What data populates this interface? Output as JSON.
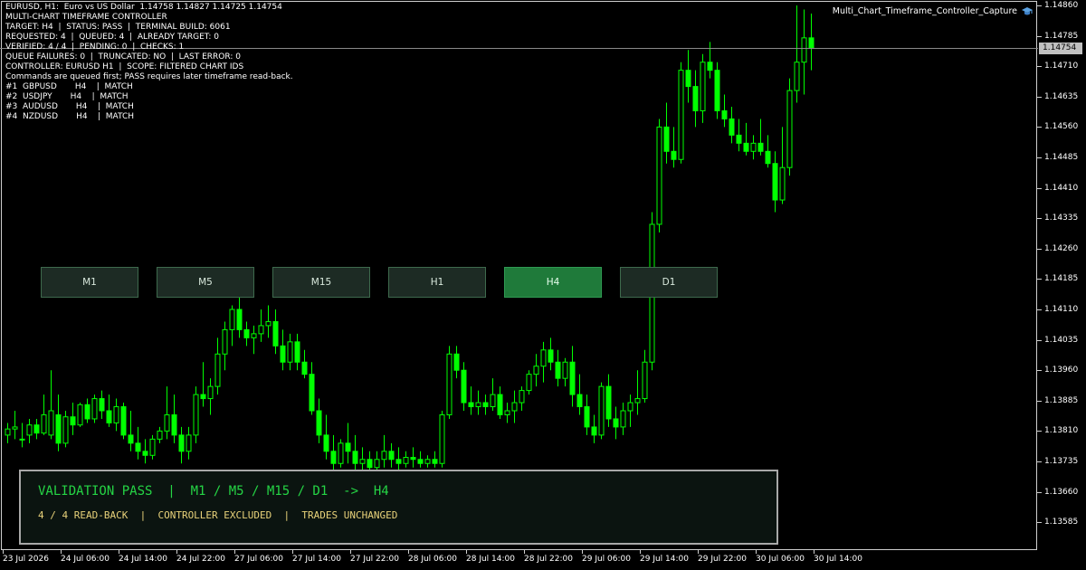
{
  "colors": {
    "background": "#000000",
    "candle_bull": "#00ff00",
    "grid_text": "#ffffff",
    "button_active": "#1f7a3a",
    "panel_title": "#25d545",
    "panel_sub": "#e8d27a"
  },
  "overlay": {
    "line1": "EURUSD, H1:  Euro vs US Dollar  1.14758 1.14827 1.14725 1.14754",
    "line2": "MULTI-CHART TIMEFRAME CONTROLLER",
    "line3": "TARGET: H4  |  STATUS: PASS  |  TERMINAL BUILD: 6061",
    "line4": "REQUESTED: 4  |  QUEUED: 4  |  ALREADY TARGET: 0",
    "line5": "VERIFIED: 4 / 4  |  PENDING: 0  |  CHECKS: 1",
    "line6": "QUEUE FAILURES: 0  |  TRUNCATED: NO  |  LAST ERROR: 0",
    "line7": "CONTROLLER: EURUSD H1  |  SCOPE: FILTERED CHART IDS",
    "line8": "Commands are queued first; PASS requires later timeframe read-back.",
    "line9": "#1  GBPUSD       H4    |  MATCH",
    "line10": "#2  USDJPY       H4    |  MATCH",
    "line11": "#3  AUDUSD       H4    |  MATCH",
    "line12": "#4  NZDUSD       H4    |  MATCH"
  },
  "script_name": "Multi_Chart_Timeframe_Controller_Capture",
  "script_icon": "graduation-cap-icon",
  "current_price": "1.14754",
  "price_labels": [
    "1.14860",
    "1.14785",
    "1.14710",
    "1.14635",
    "1.14560",
    "1.14485",
    "1.14410",
    "1.14335",
    "1.14260",
    "1.14185",
    "1.14110",
    "1.14035",
    "1.13960",
    "1.13885",
    "1.13810",
    "1.13735",
    "1.13660",
    "1.13585"
  ],
  "time_labels": [
    "23 Jul 2026",
    "24 Jul 06:00",
    "24 Jul 14:00",
    "24 Jul 22:00",
    "27 Jul 06:00",
    "27 Jul 14:00",
    "27 Jul 22:00",
    "28 Jul 06:00",
    "28 Jul 14:00",
    "28 Jul 22:00",
    "29 Jul 06:00",
    "29 Jul 14:00",
    "29 Jul 22:00",
    "30 Jul 06:00",
    "30 Jul 14:00"
  ],
  "buttons": [
    {
      "label": "M1",
      "active": false
    },
    {
      "label": "M5",
      "active": false
    },
    {
      "label": "M15",
      "active": false
    },
    {
      "label": "H1",
      "active": false
    },
    {
      "label": "H4",
      "active": true
    },
    {
      "label": "D1",
      "active": false
    }
  ],
  "panel": {
    "title": "VALIDATION PASS  |  M1 / M5 / M15 / D1  ->  H4",
    "subtitle": "4 / 4 READ-BACK  |  CONTROLLER EXCLUDED  |  TRADES UNCHANGED"
  },
  "candles": [
    [
      1.138,
      1.1383,
      1.1378,
      1.13815
    ],
    [
      1.13815,
      1.1386,
      1.1379,
      1.1382
    ],
    [
      1.1379,
      1.1383,
      1.1377,
      1.1379
    ],
    [
      1.138,
      1.1384,
      1.1378,
      1.13825
    ],
    [
      1.13825,
      1.1384,
      1.1379,
      1.13805
    ],
    [
      1.13805,
      1.139,
      1.138,
      1.1385
    ],
    [
      1.138,
      1.1396,
      1.1379,
      1.1386
    ],
    [
      1.1385,
      1.139,
      1.1376,
      1.1378
    ],
    [
      1.1378,
      1.1386,
      1.1377,
      1.13845
    ],
    [
      1.13845,
      1.1388,
      1.138,
      1.13825
    ],
    [
      1.13825,
      1.1388,
      1.1382,
      1.13875
    ],
    [
      1.13875,
      1.1389,
      1.1383,
      1.1384
    ],
    [
      1.1384,
      1.139,
      1.1383,
      1.1389
    ],
    [
      1.1389,
      1.1391,
      1.1384,
      1.1386
    ],
    [
      1.1386,
      1.139,
      1.1382,
      1.1383
    ],
    [
      1.1383,
      1.1389,
      1.1381,
      1.1387
    ],
    [
      1.1387,
      1.1388,
      1.1379,
      1.138
    ],
    [
      1.138,
      1.1386,
      1.1376,
      1.1378
    ],
    [
      1.1378,
      1.1382,
      1.1374,
      1.1376
    ],
    [
      1.1376,
      1.1379,
      1.1373,
      1.1375
    ],
    [
      1.1375,
      1.138,
      1.1374,
      1.1379
    ],
    [
      1.1379,
      1.1382,
      1.1378,
      1.1381
    ],
    [
      1.1381,
      1.1392,
      1.1379,
      1.1385
    ],
    [
      1.1385,
      1.139,
      1.1378,
      1.138
    ],
    [
      1.138,
      1.1382,
      1.1373,
      1.1376
    ],
    [
      1.1376,
      1.1382,
      1.1374,
      1.138
    ],
    [
      1.138,
      1.1392,
      1.1378,
      1.139
    ],
    [
      1.139,
      1.1398,
      1.1387,
      1.1389
    ],
    [
      1.1389,
      1.1394,
      1.1385,
      1.1392
    ],
    [
      1.1392,
      1.1404,
      1.139,
      1.14
    ],
    [
      1.14,
      1.1408,
      1.1396,
      1.1406
    ],
    [
      1.1406,
      1.1412,
      1.1402,
      1.1411
    ],
    [
      1.1411,
      1.1415,
      1.1404,
      1.1406
    ],
    [
      1.1406,
      1.1408,
      1.1402,
      1.1404
    ],
    [
      1.1404,
      1.1407,
      1.14,
      1.1405
    ],
    [
      1.1405,
      1.1411,
      1.1403,
      1.1407
    ],
    [
      1.1407,
      1.1412,
      1.1404,
      1.1408
    ],
    [
      1.1408,
      1.1411,
      1.14,
      1.1402
    ],
    [
      1.1402,
      1.1406,
      1.1396,
      1.1398
    ],
    [
      1.1398,
      1.1405,
      1.1396,
      1.1403
    ],
    [
      1.1403,
      1.1405,
      1.1396,
      1.1398
    ],
    [
      1.1398,
      1.1401,
      1.1394,
      1.1395
    ],
    [
      1.1395,
      1.1398,
      1.1385,
      1.1386
    ],
    [
      1.1386,
      1.1389,
      1.1378,
      1.138
    ],
    [
      1.138,
      1.1385,
      1.1374,
      1.1376
    ],
    [
      1.1376,
      1.138,
      1.137,
      1.1373
    ],
    [
      1.1373,
      1.1379,
      1.1372,
      1.1378
    ],
    [
      1.1378,
      1.1383,
      1.1373,
      1.1376
    ],
    [
      1.1376,
      1.138,
      1.1371,
      1.1373
    ],
    [
      1.1373,
      1.1377,
      1.137,
      1.1374
    ],
    [
      1.1374,
      1.1376,
      1.137,
      1.1372
    ],
    [
      1.1372,
      1.1376,
      1.1369,
      1.1374
    ],
    [
      1.1374,
      1.138,
      1.1372,
      1.1376
    ],
    [
      1.1376,
      1.1378,
      1.1372,
      1.1374
    ],
    [
      1.1374,
      1.1377,
      1.1371,
      1.1373
    ],
    [
      1.1373,
      1.1376,
      1.1372,
      1.13745
    ],
    [
      1.13745,
      1.1377,
      1.1372,
      1.1374
    ],
    [
      1.1374,
      1.1376,
      1.1372,
      1.1373
    ],
    [
      1.1373,
      1.1375,
      1.1372,
      1.1374
    ],
    [
      1.1374,
      1.1376,
      1.1372,
      1.1373
    ],
    [
      1.1373,
      1.1386,
      1.1372,
      1.1385
    ],
    [
      1.1385,
      1.1402,
      1.1384,
      1.14
    ],
    [
      1.14,
      1.1402,
      1.1394,
      1.1396
    ],
    [
      1.1396,
      1.1398,
      1.1386,
      1.1388
    ],
    [
      1.1388,
      1.1392,
      1.1385,
      1.1387
    ],
    [
      1.1387,
      1.1391,
      1.1385,
      1.1388
    ],
    [
      1.1388,
      1.139,
      1.1385,
      1.1387
    ],
    [
      1.1387,
      1.1394,
      1.1386,
      1.139
    ],
    [
      1.139,
      1.1392,
      1.1384,
      1.1385
    ],
    [
      1.1385,
      1.1388,
      1.1383,
      1.1386
    ],
    [
      1.1386,
      1.1391,
      1.1383,
      1.1388
    ],
    [
      1.1388,
      1.1392,
      1.1386,
      1.1391
    ],
    [
      1.1391,
      1.1396,
      1.139,
      1.1395
    ],
    [
      1.1395,
      1.14,
      1.1392,
      1.1397
    ],
    [
      1.1397,
      1.1403,
      1.1393,
      1.1401
    ],
    [
      1.1401,
      1.1404,
      1.1396,
      1.1398
    ],
    [
      1.1398,
      1.1401,
      1.1392,
      1.1394
    ],
    [
      1.1394,
      1.1399,
      1.1392,
      1.1398
    ],
    [
      1.1398,
      1.1402,
      1.1387,
      1.139
    ],
    [
      1.139,
      1.1395,
      1.1385,
      1.1387
    ],
    [
      1.1387,
      1.139,
      1.138,
      1.1382
    ],
    [
      1.1382,
      1.1385,
      1.1378,
      1.138
    ],
    [
      1.138,
      1.1393,
      1.1379,
      1.1392
    ],
    [
      1.1392,
      1.1395,
      1.1382,
      1.1384
    ],
    [
      1.1384,
      1.1387,
      1.1379,
      1.1382
    ],
    [
      1.1382,
      1.1388,
      1.138,
      1.1386
    ],
    [
      1.1386,
      1.139,
      1.1382,
      1.1388
    ],
    [
      1.1388,
      1.1396,
      1.1385,
      1.1389
    ],
    [
      1.1389,
      1.1401,
      1.1388,
      1.1398
    ],
    [
      1.1398,
      1.1435,
      1.1396,
      1.1432
    ],
    [
      1.1432,
      1.1458,
      1.143,
      1.1456
    ],
    [
      1.1456,
      1.1462,
      1.1447,
      1.145
    ],
    [
      1.145,
      1.1456,
      1.1446,
      1.1448
    ],
    [
      1.1448,
      1.1472,
      1.1447,
      1.147
    ],
    [
      1.147,
      1.1475,
      1.1462,
      1.1466
    ],
    [
      1.1466,
      1.147,
      1.1456,
      1.146
    ],
    [
      1.146,
      1.1474,
      1.1457,
      1.1472
    ],
    [
      1.1472,
      1.1477,
      1.1468,
      1.147
    ],
    [
      1.147,
      1.1472,
      1.1458,
      1.146
    ],
    [
      1.146,
      1.1464,
      1.1456,
      1.1458
    ],
    [
      1.1458,
      1.1461,
      1.1452,
      1.1454
    ],
    [
      1.1454,
      1.1458,
      1.145,
      1.1452
    ],
    [
      1.1452,
      1.1457,
      1.1449,
      1.145
    ],
    [
      1.145,
      1.1454,
      1.1448,
      1.1452
    ],
    [
      1.1452,
      1.1458,
      1.1449,
      1.145
    ],
    [
      1.145,
      1.1454,
      1.1446,
      1.1447
    ],
    [
      1.1447,
      1.145,
      1.1435,
      1.1438
    ],
    [
      1.1438,
      1.1456,
      1.1437,
      1.1446
    ],
    [
      1.1446,
      1.1468,
      1.1444,
      1.1465
    ],
    [
      1.1465,
      1.1486,
      1.1462,
      1.1472
    ],
    [
      1.1472,
      1.1485,
      1.1464,
      1.1478
    ],
    [
      1.1478,
      1.1484,
      1.147,
      1.14754
    ]
  ]
}
